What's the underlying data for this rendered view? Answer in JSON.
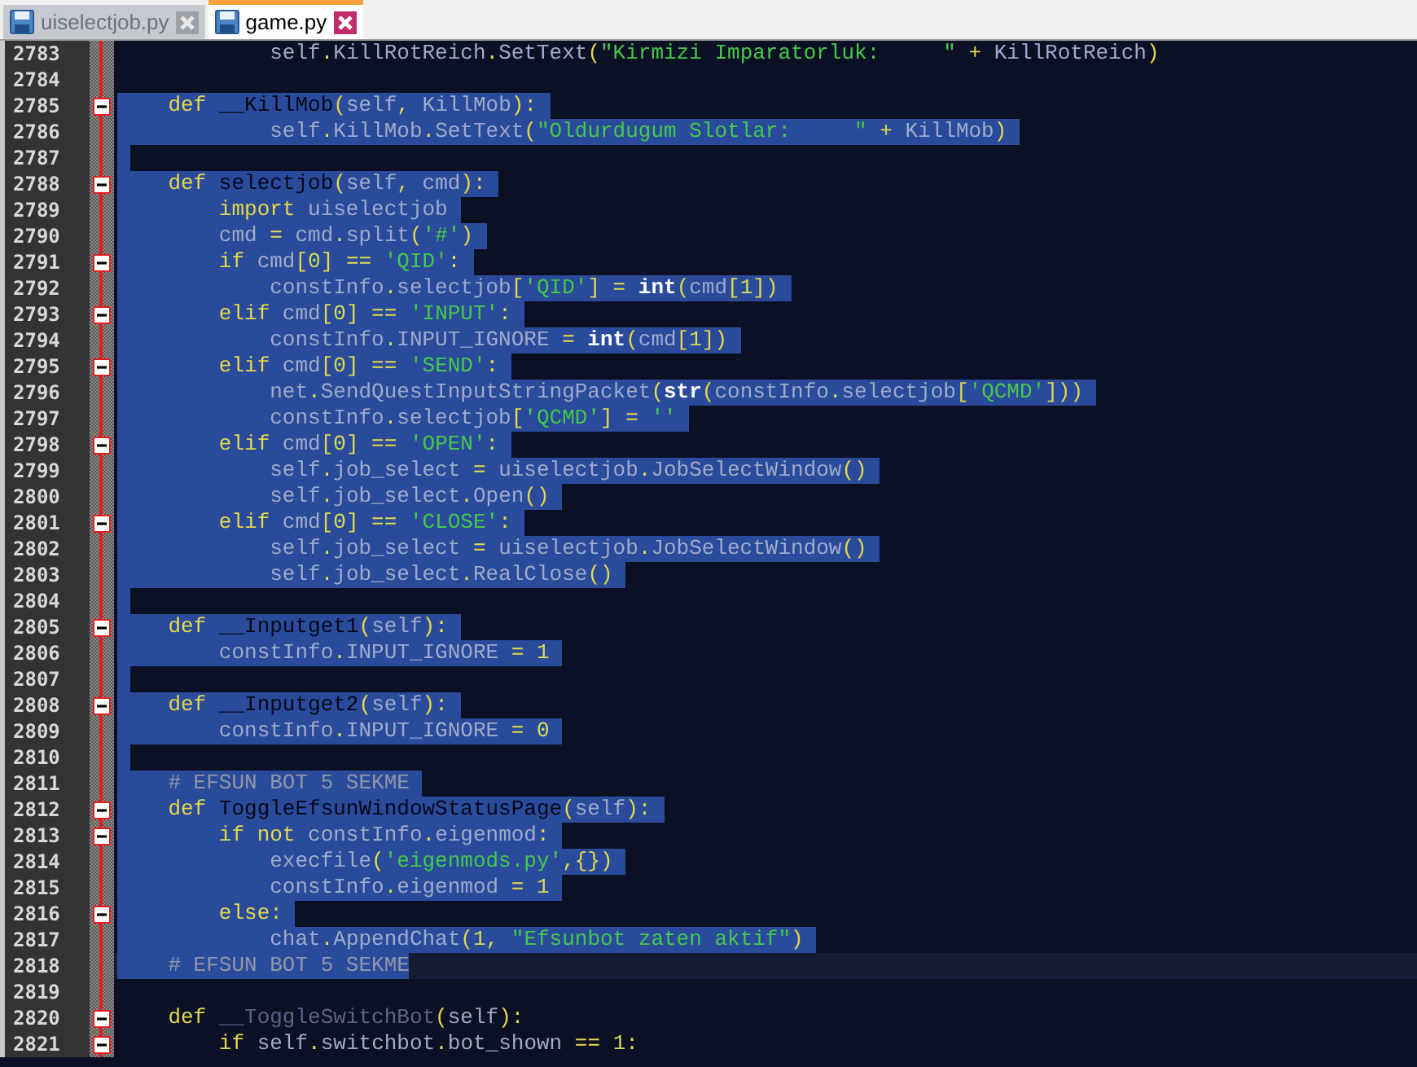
{
  "tabs": [
    {
      "label": "uiselectjob.py",
      "selected": false
    },
    {
      "label": "game.py",
      "selected": true
    }
  ],
  "lines": [
    {
      "number": "2783",
      "fold_marker": false,
      "selected": false,
      "current": false,
      "tokens": [
        {
          "kind": "i",
          "text": "            self"
        },
        {
          "kind": "o",
          "text": "."
        },
        {
          "kind": "i",
          "text": "KillRotReich"
        },
        {
          "kind": "o",
          "text": "."
        },
        {
          "kind": "i",
          "text": "SetText"
        },
        {
          "kind": "o",
          "text": "("
        },
        {
          "kind": "s",
          "text": "\"Kirmizi Imparatorluk:     \""
        },
        {
          "kind": "o",
          "text": " + "
        },
        {
          "kind": "i",
          "text": "KillRotReich"
        },
        {
          "kind": "o",
          "text": ")"
        }
      ]
    },
    {
      "number": "2784",
      "fold_marker": false,
      "selected": false,
      "current": false
    },
    {
      "number": "2785",
      "fold_marker": true,
      "selected": true,
      "current": false,
      "tokens": [
        {
          "kind": "k",
          "text": "    def "
        },
        {
          "kind": "f",
          "text": "__KillMob"
        },
        {
          "kind": "o",
          "text": "("
        },
        {
          "kind": "i",
          "text": "self"
        },
        {
          "kind": "o",
          "text": ", "
        },
        {
          "kind": "i",
          "text": "KillMob"
        },
        {
          "kind": "o",
          "text": "):"
        }
      ]
    },
    {
      "number": "2786",
      "fold_marker": false,
      "selected": true,
      "current": false,
      "tokens": [
        {
          "kind": "i",
          "text": "            self"
        },
        {
          "kind": "o",
          "text": "."
        },
        {
          "kind": "i",
          "text": "KillMob"
        },
        {
          "kind": "o",
          "text": "."
        },
        {
          "kind": "i",
          "text": "SetText"
        },
        {
          "kind": "o",
          "text": "("
        },
        {
          "kind": "s",
          "text": "\"Oldurdugum Slotlar:     \""
        },
        {
          "kind": "o",
          "text": " + "
        },
        {
          "kind": "i",
          "text": "KillMob"
        },
        {
          "kind": "o",
          "text": ")"
        }
      ]
    },
    {
      "number": "2787",
      "fold_marker": false,
      "selected": true,
      "current": false
    },
    {
      "number": "2788",
      "fold_marker": true,
      "selected": true,
      "current": false,
      "tokens": [
        {
          "kind": "k",
          "text": "    def "
        },
        {
          "kind": "f",
          "text": "selectjob"
        },
        {
          "kind": "o",
          "text": "("
        },
        {
          "kind": "i",
          "text": "self"
        },
        {
          "kind": "o",
          "text": ", "
        },
        {
          "kind": "i",
          "text": "cmd"
        },
        {
          "kind": "o",
          "text": "):"
        }
      ]
    },
    {
      "number": "2789",
      "fold_marker": false,
      "selected": true,
      "current": false,
      "tokens": [
        {
          "kind": "k",
          "text": "        import "
        },
        {
          "kind": "i",
          "text": "uiselectjob"
        }
      ]
    },
    {
      "number": "2790",
      "fold_marker": false,
      "selected": true,
      "current": false,
      "tokens": [
        {
          "kind": "i",
          "text": "        cmd"
        },
        {
          "kind": "o",
          "text": " = "
        },
        {
          "kind": "i",
          "text": "cmd"
        },
        {
          "kind": "o",
          "text": "."
        },
        {
          "kind": "i",
          "text": "split"
        },
        {
          "kind": "o",
          "text": "("
        },
        {
          "kind": "s",
          "text": "'#'"
        },
        {
          "kind": "o",
          "text": ")"
        }
      ]
    },
    {
      "number": "2791",
      "fold_marker": true,
      "selected": true,
      "current": false,
      "tokens": [
        {
          "kind": "k",
          "text": "        if "
        },
        {
          "kind": "i",
          "text": "cmd"
        },
        {
          "kind": "o",
          "text": "["
        },
        {
          "kind": "n",
          "text": "0"
        },
        {
          "kind": "o",
          "text": "] == "
        },
        {
          "kind": "s",
          "text": "'QID'"
        },
        {
          "kind": "o",
          "text": ":"
        }
      ]
    },
    {
      "number": "2792",
      "fold_marker": false,
      "selected": true,
      "current": false,
      "tokens": [
        {
          "kind": "i",
          "text": "            constInfo"
        },
        {
          "kind": "o",
          "text": "."
        },
        {
          "kind": "i",
          "text": "selectjob"
        },
        {
          "kind": "o",
          "text": "["
        },
        {
          "kind": "s",
          "text": "'QID'"
        },
        {
          "kind": "o",
          "text": "] = "
        },
        {
          "kind": "b",
          "text": "int"
        },
        {
          "kind": "o",
          "text": "("
        },
        {
          "kind": "i",
          "text": "cmd"
        },
        {
          "kind": "o",
          "text": "["
        },
        {
          "kind": "n",
          "text": "1"
        },
        {
          "kind": "o",
          "text": "])"
        }
      ]
    },
    {
      "number": "2793",
      "fold_marker": true,
      "selected": true,
      "current": false,
      "tokens": [
        {
          "kind": "k",
          "text": "        elif "
        },
        {
          "kind": "i",
          "text": "cmd"
        },
        {
          "kind": "o",
          "text": "["
        },
        {
          "kind": "n",
          "text": "0"
        },
        {
          "kind": "o",
          "text": "] == "
        },
        {
          "kind": "s",
          "text": "'INPUT'"
        },
        {
          "kind": "o",
          "text": ":"
        }
      ]
    },
    {
      "number": "2794",
      "fold_marker": false,
      "selected": true,
      "current": false,
      "tokens": [
        {
          "kind": "i",
          "text": "            constInfo"
        },
        {
          "kind": "o",
          "text": "."
        },
        {
          "kind": "i",
          "text": "INPUT_IGNORE"
        },
        {
          "kind": "o",
          "text": " = "
        },
        {
          "kind": "b",
          "text": "int"
        },
        {
          "kind": "o",
          "text": "("
        },
        {
          "kind": "i",
          "text": "cmd"
        },
        {
          "kind": "o",
          "text": "["
        },
        {
          "kind": "n",
          "text": "1"
        },
        {
          "kind": "o",
          "text": "])"
        }
      ]
    },
    {
      "number": "2795",
      "fold_marker": true,
      "selected": true,
      "current": false,
      "tokens": [
        {
          "kind": "k",
          "text": "        elif "
        },
        {
          "kind": "i",
          "text": "cmd"
        },
        {
          "kind": "o",
          "text": "["
        },
        {
          "kind": "n",
          "text": "0"
        },
        {
          "kind": "o",
          "text": "] == "
        },
        {
          "kind": "s",
          "text": "'SEND'"
        },
        {
          "kind": "o",
          "text": ":"
        }
      ]
    },
    {
      "number": "2796",
      "fold_marker": false,
      "selected": true,
      "current": false,
      "tokens": [
        {
          "kind": "i",
          "text": "            net"
        },
        {
          "kind": "o",
          "text": "."
        },
        {
          "kind": "i",
          "text": "SendQuestInputStringPacket"
        },
        {
          "kind": "o",
          "text": "("
        },
        {
          "kind": "b",
          "text": "str"
        },
        {
          "kind": "o",
          "text": "("
        },
        {
          "kind": "i",
          "text": "constInfo"
        },
        {
          "kind": "o",
          "text": "."
        },
        {
          "kind": "i",
          "text": "selectjob"
        },
        {
          "kind": "o",
          "text": "["
        },
        {
          "kind": "s",
          "text": "'QCMD'"
        },
        {
          "kind": "o",
          "text": "]))"
        }
      ]
    },
    {
      "number": "2797",
      "fold_marker": false,
      "selected": true,
      "current": false,
      "tokens": [
        {
          "kind": "i",
          "text": "            constInfo"
        },
        {
          "kind": "o",
          "text": "."
        },
        {
          "kind": "i",
          "text": "selectjob"
        },
        {
          "kind": "o",
          "text": "["
        },
        {
          "kind": "s",
          "text": "'QCMD'"
        },
        {
          "kind": "o",
          "text": "] = "
        },
        {
          "kind": "s",
          "text": "''"
        }
      ]
    },
    {
      "number": "2798",
      "fold_marker": true,
      "selected": true,
      "current": false,
      "tokens": [
        {
          "kind": "k",
          "text": "        elif "
        },
        {
          "kind": "i",
          "text": "cmd"
        },
        {
          "kind": "o",
          "text": "["
        },
        {
          "kind": "n",
          "text": "0"
        },
        {
          "kind": "o",
          "text": "] == "
        },
        {
          "kind": "s",
          "text": "'OPEN'"
        },
        {
          "kind": "o",
          "text": ":"
        }
      ]
    },
    {
      "number": "2799",
      "fold_marker": false,
      "selected": true,
      "current": false,
      "tokens": [
        {
          "kind": "i",
          "text": "            self"
        },
        {
          "kind": "o",
          "text": "."
        },
        {
          "kind": "i",
          "text": "job_select"
        },
        {
          "kind": "o",
          "text": " = "
        },
        {
          "kind": "i",
          "text": "uiselectjob"
        },
        {
          "kind": "o",
          "text": "."
        },
        {
          "kind": "i",
          "text": "JobSelectWindow"
        },
        {
          "kind": "o",
          "text": "()"
        }
      ]
    },
    {
      "number": "2800",
      "fold_marker": false,
      "selected": true,
      "current": false,
      "tokens": [
        {
          "kind": "i",
          "text": "            self"
        },
        {
          "kind": "o",
          "text": "."
        },
        {
          "kind": "i",
          "text": "job_select"
        },
        {
          "kind": "o",
          "text": "."
        },
        {
          "kind": "i",
          "text": "Open"
        },
        {
          "kind": "o",
          "text": "()"
        }
      ]
    },
    {
      "number": "2801",
      "fold_marker": true,
      "selected": true,
      "current": false,
      "tokens": [
        {
          "kind": "k",
          "text": "        elif "
        },
        {
          "kind": "i",
          "text": "cmd"
        },
        {
          "kind": "o",
          "text": "["
        },
        {
          "kind": "n",
          "text": "0"
        },
        {
          "kind": "o",
          "text": "] == "
        },
        {
          "kind": "s",
          "text": "'CLOSE'"
        },
        {
          "kind": "o",
          "text": ":"
        }
      ]
    },
    {
      "number": "2802",
      "fold_marker": false,
      "selected": true,
      "current": false,
      "tokens": [
        {
          "kind": "i",
          "text": "            self"
        },
        {
          "kind": "o",
          "text": "."
        },
        {
          "kind": "i",
          "text": "job_select"
        },
        {
          "kind": "o",
          "text": " = "
        },
        {
          "kind": "i",
          "text": "uiselectjob"
        },
        {
          "kind": "o",
          "text": "."
        },
        {
          "kind": "i",
          "text": "JobSelectWindow"
        },
        {
          "kind": "o",
          "text": "()"
        }
      ]
    },
    {
      "number": "2803",
      "fold_marker": false,
      "selected": true,
      "current": false,
      "tokens": [
        {
          "kind": "i",
          "text": "            self"
        },
        {
          "kind": "o",
          "text": "."
        },
        {
          "kind": "i",
          "text": "job_select"
        },
        {
          "kind": "o",
          "text": "."
        },
        {
          "kind": "i",
          "text": "RealClose"
        },
        {
          "kind": "o",
          "text": "()"
        }
      ]
    },
    {
      "number": "2804",
      "fold_marker": false,
      "selected": true,
      "current": false
    },
    {
      "number": "2805",
      "fold_marker": true,
      "selected": true,
      "current": false,
      "tokens": [
        {
          "kind": "k",
          "text": "    def "
        },
        {
          "kind": "f",
          "text": "__Inputget1"
        },
        {
          "kind": "o",
          "text": "("
        },
        {
          "kind": "i",
          "text": "self"
        },
        {
          "kind": "o",
          "text": "):"
        }
      ]
    },
    {
      "number": "2806",
      "fold_marker": false,
      "selected": true,
      "current": false,
      "tokens": [
        {
          "kind": "i",
          "text": "        constInfo"
        },
        {
          "kind": "o",
          "text": "."
        },
        {
          "kind": "i",
          "text": "INPUT_IGNORE"
        },
        {
          "kind": "o",
          "text": " = "
        },
        {
          "kind": "n",
          "text": "1"
        }
      ]
    },
    {
      "number": "2807",
      "fold_marker": false,
      "selected": true,
      "current": false
    },
    {
      "number": "2808",
      "fold_marker": true,
      "selected": true,
      "current": false,
      "tokens": [
        {
          "kind": "k",
          "text": "    def "
        },
        {
          "kind": "f",
          "text": "__Inputget2"
        },
        {
          "kind": "o",
          "text": "("
        },
        {
          "kind": "i",
          "text": "self"
        },
        {
          "kind": "o",
          "text": "):"
        }
      ]
    },
    {
      "number": "2809",
      "fold_marker": false,
      "selected": true,
      "current": false,
      "tokens": [
        {
          "kind": "i",
          "text": "        constInfo"
        },
        {
          "kind": "o",
          "text": "."
        },
        {
          "kind": "i",
          "text": "INPUT_IGNORE"
        },
        {
          "kind": "o",
          "text": " = "
        },
        {
          "kind": "n",
          "text": "0"
        }
      ]
    },
    {
      "number": "2810",
      "fold_marker": false,
      "selected": true,
      "current": false
    },
    {
      "number": "2811",
      "fold_marker": false,
      "selected": true,
      "current": false,
      "tokens": [
        {
          "kind": "c",
          "text": "    # EFSUN BOT 5 SEKME"
        }
      ]
    },
    {
      "number": "2812",
      "fold_marker": true,
      "selected": true,
      "current": false,
      "tokens": [
        {
          "kind": "k",
          "text": "    def "
        },
        {
          "kind": "f",
          "text": "ToggleEfsunWindowStatusPage"
        },
        {
          "kind": "o",
          "text": "("
        },
        {
          "kind": "i",
          "text": "self"
        },
        {
          "kind": "o",
          "text": "):"
        }
      ]
    },
    {
      "number": "2813",
      "fold_marker": true,
      "selected": true,
      "current": false,
      "tokens": [
        {
          "kind": "k",
          "text": "        if not "
        },
        {
          "kind": "i",
          "text": "constInfo"
        },
        {
          "kind": "o",
          "text": "."
        },
        {
          "kind": "i",
          "text": "eigenmod"
        },
        {
          "kind": "o",
          "text": ":"
        }
      ]
    },
    {
      "number": "2814",
      "fold_marker": false,
      "selected": true,
      "current": false,
      "tokens": [
        {
          "kind": "i",
          "text": "            execfile"
        },
        {
          "kind": "o",
          "text": "("
        },
        {
          "kind": "s",
          "text": "'eigenmods.py'"
        },
        {
          "kind": "o",
          "text": ",{})"
        }
      ]
    },
    {
      "number": "2815",
      "fold_marker": false,
      "selected": true,
      "current": false,
      "tokens": [
        {
          "kind": "i",
          "text": "            constInfo"
        },
        {
          "kind": "o",
          "text": "."
        },
        {
          "kind": "i",
          "text": "eigenmod"
        },
        {
          "kind": "o",
          "text": " = "
        },
        {
          "kind": "n",
          "text": "1"
        }
      ]
    },
    {
      "number": "2816",
      "fold_marker": true,
      "selected": true,
      "current": false,
      "tokens": [
        {
          "kind": "k",
          "text": "        else"
        },
        {
          "kind": "o",
          "text": ":"
        }
      ]
    },
    {
      "number": "2817",
      "fold_marker": false,
      "selected": true,
      "current": false,
      "tokens": [
        {
          "kind": "i",
          "text": "            chat"
        },
        {
          "kind": "o",
          "text": "."
        },
        {
          "kind": "i",
          "text": "AppendChat"
        },
        {
          "kind": "o",
          "text": "("
        },
        {
          "kind": "n",
          "text": "1"
        },
        {
          "kind": "o",
          "text": ", "
        },
        {
          "kind": "s",
          "text": "\"Efsunbot zaten aktif\""
        },
        {
          "kind": "o",
          "text": ")"
        }
      ]
    },
    {
      "number": "2818",
      "fold_marker": false,
      "selected": true,
      "current": true,
      "tokens": [
        {
          "kind": "c",
          "text": "    # EFSUN BOT 5 SEKME"
        }
      ]
    },
    {
      "number": "2819",
      "fold_marker": false,
      "selected": false,
      "current": false
    },
    {
      "number": "2820",
      "fold_marker": true,
      "selected": false,
      "current": false,
      "tokens": [
        {
          "kind": "k",
          "text": "    def "
        },
        {
          "kind": "f",
          "text": "__ToggleSwitchBot"
        },
        {
          "kind": "o",
          "text": "("
        },
        {
          "kind": "i",
          "text": "self"
        },
        {
          "kind": "o",
          "text": "):"
        }
      ]
    },
    {
      "number": "2821",
      "fold_marker": true,
      "selected": false,
      "current": false,
      "tokens": [
        {
          "kind": "k",
          "text": "        if "
        },
        {
          "kind": "i",
          "text": "self"
        },
        {
          "kind": "o",
          "text": "."
        },
        {
          "kind": "i",
          "text": "switchbot"
        },
        {
          "kind": "o",
          "text": "."
        },
        {
          "kind": "i",
          "text": "bot_shown"
        },
        {
          "kind": "o",
          "text": " == "
        },
        {
          "kind": "n",
          "text": "1"
        },
        {
          "kind": "o",
          "text": ":"
        }
      ]
    }
  ]
}
